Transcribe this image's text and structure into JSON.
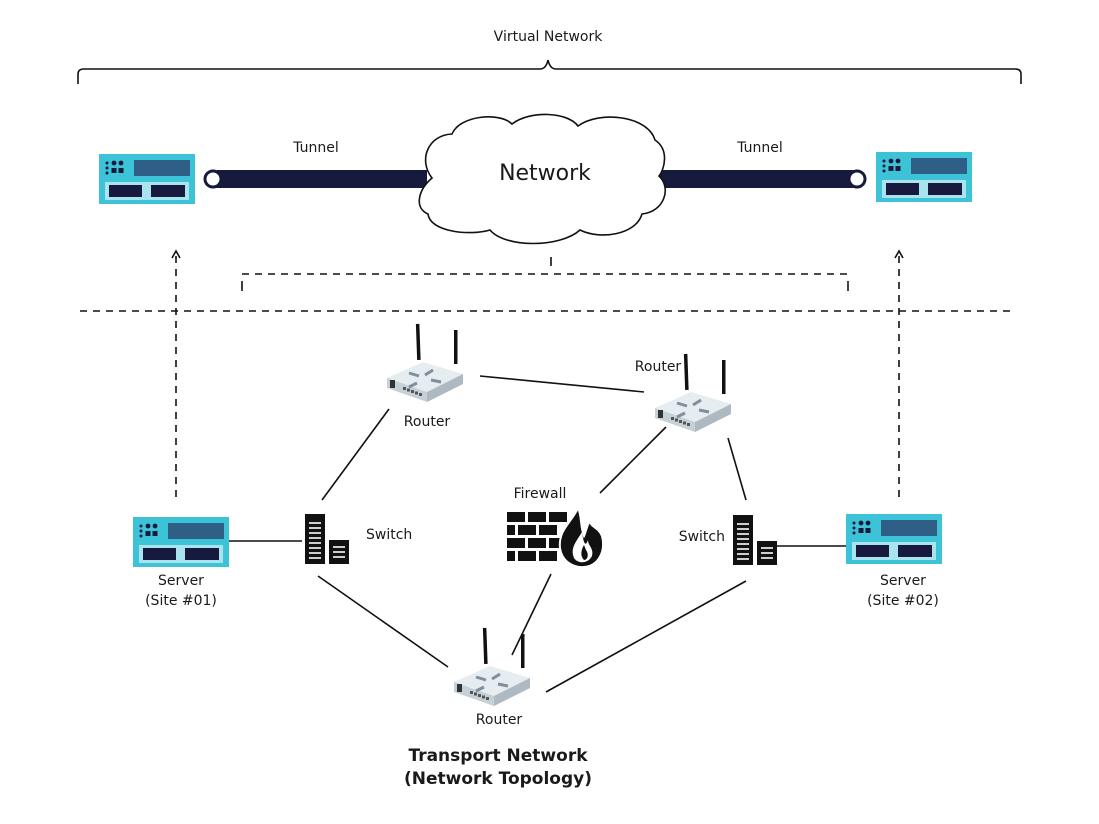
{
  "title": "Virtual Network",
  "cloud_label": "Network",
  "tunnels": [
    "Tunnel",
    "Tunnel"
  ],
  "nodes": {
    "router_top_left": "Router",
    "router_top_right": "Router",
    "router_bottom": "Router",
    "switch_left": "Switch",
    "switch_right": "Switch",
    "firewall": "Firewall",
    "server_left": [
      "Server",
      "(Site #01)"
    ],
    "server_right": [
      "Server",
      "(Site #02)"
    ]
  },
  "footer": [
    "Transport Network",
    "(Network Topology)"
  ],
  "colors": {
    "server_body": "#3cc3d8",
    "server_panel": "#a8e3ee",
    "server_screen": "#2f5f86",
    "server_slot": "#171a3e",
    "tunnel": "#161a3c",
    "router_body": "#dfe7ec",
    "router_arrow": "#7f8f9c"
  }
}
